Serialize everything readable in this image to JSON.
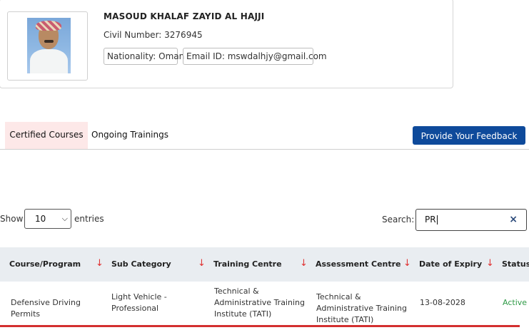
{
  "profile": {
    "name": "MASOUD KHALAF ZAYID AL HAJJI",
    "civil_number": "Civil Number: 3276945",
    "nationality": "Nationality: Oman",
    "email": "Email ID: mswdalhjy@gmail.com"
  },
  "tabs": [
    {
      "label": "Certified Courses",
      "active": true
    },
    {
      "label": "Ongoing Trainings",
      "active": false
    }
  ],
  "feedback_button": "Provide Your Feedback",
  "table_controls": {
    "show_label": "Show",
    "entries_value": "10",
    "entries_label": "entries",
    "search_label": "Search:",
    "search_value": "PR"
  },
  "table": {
    "columns": [
      "Course/Program",
      "Sub Category",
      "Training Centre",
      "Assessment Centre",
      "Date of Expiry",
      "Status"
    ],
    "rows": [
      {
        "course": "Defensive Driving Permits",
        "sub_category": "Light Vehicle - Professional",
        "training_centre": "Technical & Administrative Training Institute (TATI)",
        "assessment_centre": "Technical & Administrative Training Institute (TATI)",
        "date_of_expiry": "13-08-2028",
        "status": "Active"
      }
    ]
  },
  "colors": {
    "primary_button": "#0e4a9b",
    "active_tab_bg": "#fde8e8",
    "sort_arrow": "#e03131",
    "status_active": "#2e9a46",
    "table_header_bg": "#e9edf1"
  }
}
